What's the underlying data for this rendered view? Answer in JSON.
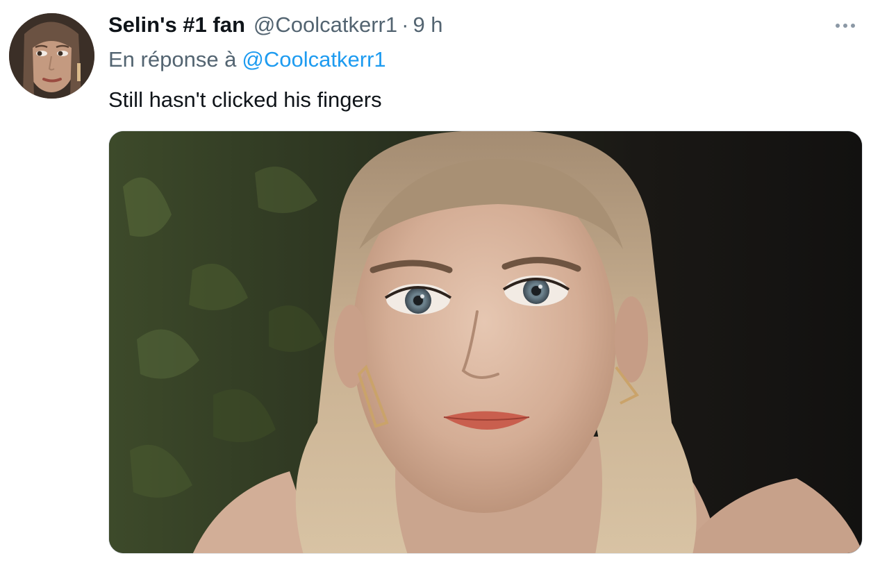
{
  "tweet": {
    "author": {
      "display_name": "Selin's #1 fan",
      "handle": "@Coolcatkerr1",
      "avatar_icon": "avatar-photo"
    },
    "separator": "·",
    "time": "9 h",
    "reply_to": {
      "prefix": "En réponse à",
      "handle": "@Coolcatkerr1"
    },
    "text": "Still hasn't clicked his fingers",
    "media": {
      "kind": "photo",
      "icon": "photo-image"
    },
    "more_icon": "more-dots-icon"
  },
  "colors": {
    "text_primary": "#0f1419",
    "text_secondary": "#536471",
    "link": "#1d9bf0"
  }
}
